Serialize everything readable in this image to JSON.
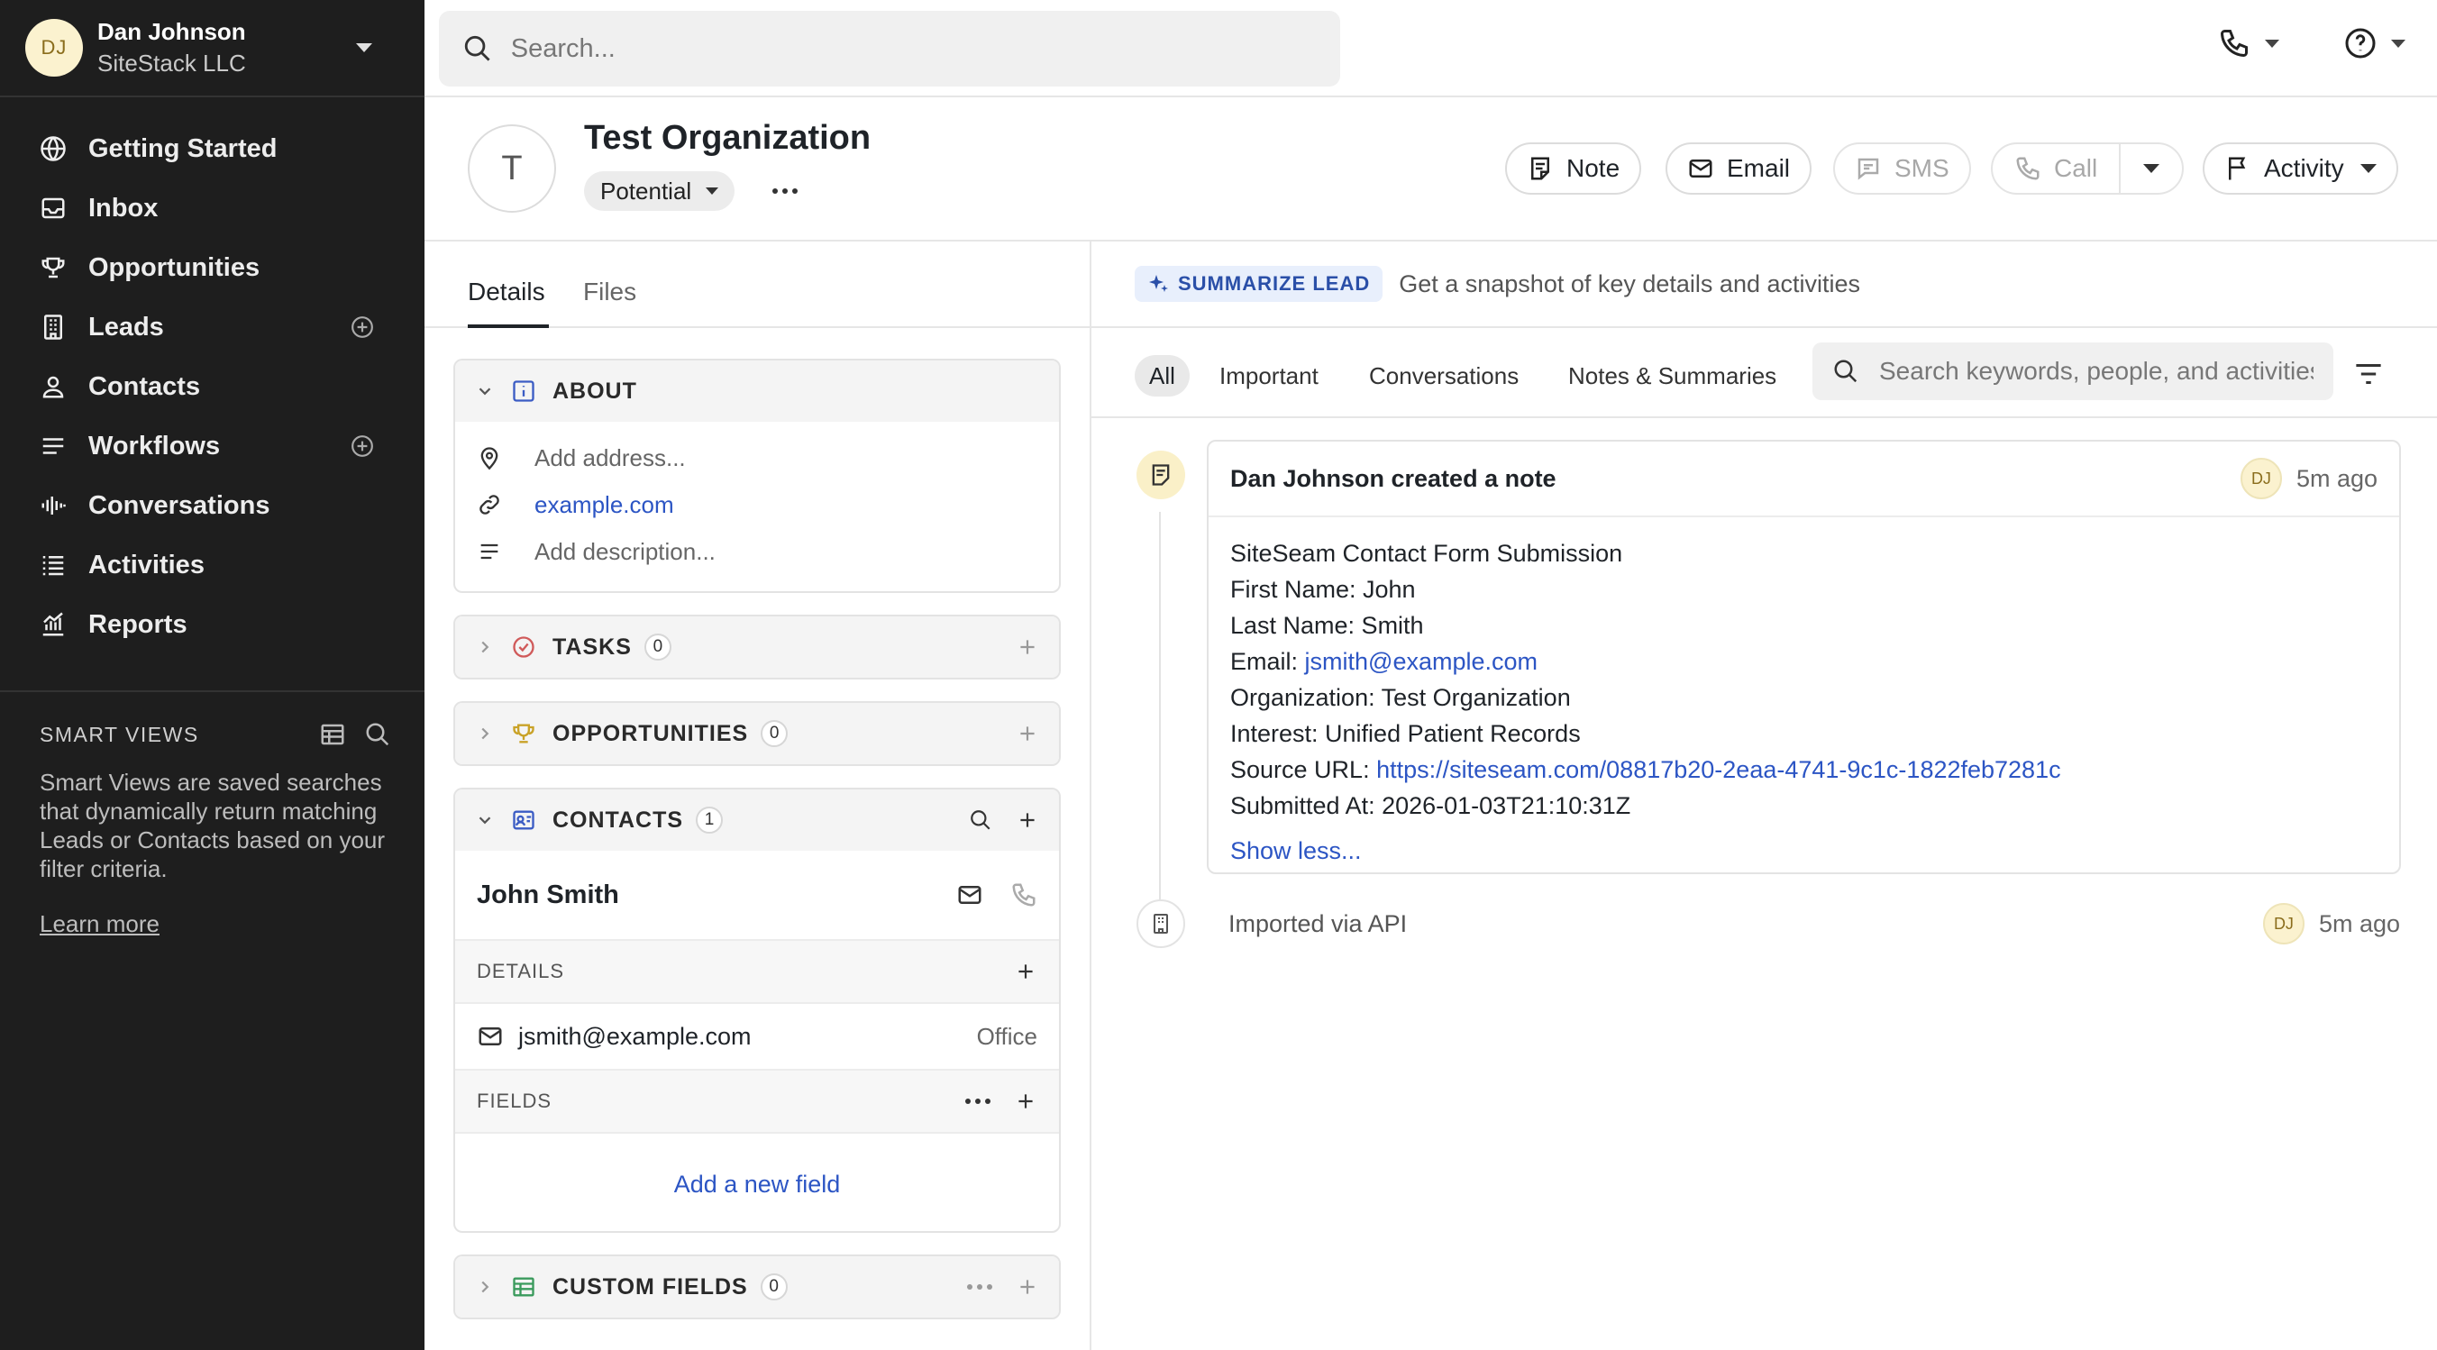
{
  "user": {
    "initials": "DJ",
    "name": "Dan Johnson",
    "org": "SiteStack LLC"
  },
  "nav": {
    "items": [
      {
        "label": "Getting Started",
        "icon": "globe-icon"
      },
      {
        "label": "Inbox",
        "icon": "inbox-icon"
      },
      {
        "label": "Opportunities",
        "icon": "trophy-icon"
      },
      {
        "label": "Leads",
        "icon": "building-icon",
        "add": true
      },
      {
        "label": "Contacts",
        "icon": "person-icon"
      },
      {
        "label": "Workflows",
        "icon": "list-icon",
        "add": true
      },
      {
        "label": "Conversations",
        "icon": "audio-wave-icon"
      },
      {
        "label": "Activities",
        "icon": "stack-icon"
      },
      {
        "label": "Reports",
        "icon": "chart-icon"
      }
    ]
  },
  "smart_views": {
    "title": "SMART VIEWS",
    "description": "Smart Views are saved searches that dynamically return matching Leads or Contacts based on your filter criteria.",
    "learn_more": "Learn more"
  },
  "search": {
    "placeholder": "Search..."
  },
  "org": {
    "initial": "T",
    "name": "Test Organization",
    "status": "Potential"
  },
  "actions": {
    "note": "Note",
    "email": "Email",
    "sms": "SMS",
    "call": "Call",
    "activity": "Activity"
  },
  "tabs": {
    "details": "Details",
    "files": "Files"
  },
  "about": {
    "title": "ABOUT",
    "address_placeholder": "Add address...",
    "website": "example.com",
    "description_placeholder": "Add description..."
  },
  "tasks": {
    "title": "TASKS",
    "count": "0"
  },
  "opportunities": {
    "title": "OPPORTUNITIES",
    "count": "0"
  },
  "contacts": {
    "title": "CONTACTS",
    "count": "1",
    "name": "John Smith",
    "details_label": "DETAILS",
    "email": "jsmith@example.com",
    "email_type": "Office",
    "fields_label": "FIELDS",
    "add_field": "Add a new field"
  },
  "custom_fields": {
    "title": "CUSTOM FIELDS",
    "count": "0"
  },
  "summarize": {
    "badge": "SUMMARIZE LEAD",
    "text": "Get a snapshot of key details and activities"
  },
  "filters": {
    "all": "All",
    "important": "Important",
    "conversations": "Conversations",
    "notes": "Notes & Summaries",
    "search_placeholder": "Search keywords, people, and activities"
  },
  "note": {
    "title": "Dan Johnson created a note",
    "initials": "DJ",
    "time": "5m ago",
    "line1": "SiteSeam Contact Form Submission",
    "line2": "First Name: John",
    "line3": "Last Name: Smith",
    "email_label": "Email: ",
    "email": "jsmith@example.com",
    "line5": "Organization: Test Organization",
    "line6": "Interest: Unified Patient Records",
    "source_label": "Source URL: ",
    "source_url": "https://siteseam.com/08817b20-2eaa-4741-9c1c-1822feb7281c",
    "line8": "Submitted At: 2026-01-03T21:10:31Z",
    "show_less": "Show less..."
  },
  "import": {
    "text": "Imported via API",
    "initials": "DJ",
    "time": "5m ago"
  },
  "colors": {
    "sidebar_bg": "#1e1e1e",
    "link": "#2c55c4",
    "avatar_bg": "#fbf2cf",
    "badge_bg": "#e8effc"
  }
}
